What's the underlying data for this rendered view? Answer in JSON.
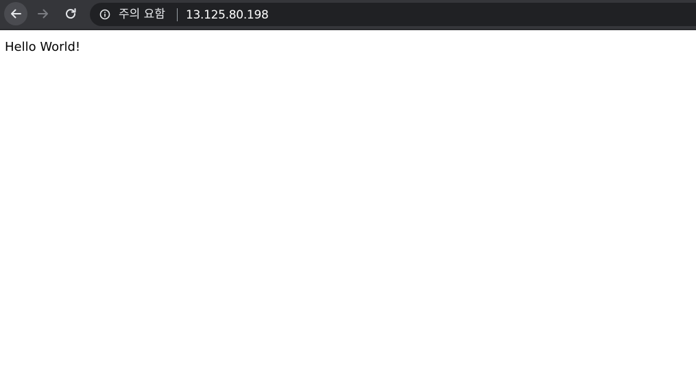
{
  "browser": {
    "toolbar": {
      "background": "#35363a",
      "back_icon": "arrow-left-icon",
      "forward_icon": "arrow-right-icon",
      "reload_icon": "reload-icon"
    },
    "omnibox": {
      "security_icon": "info-icon",
      "security_label": "주의 요함",
      "url": "13.125.80.198"
    }
  },
  "page": {
    "body_text": "Hello World!"
  }
}
